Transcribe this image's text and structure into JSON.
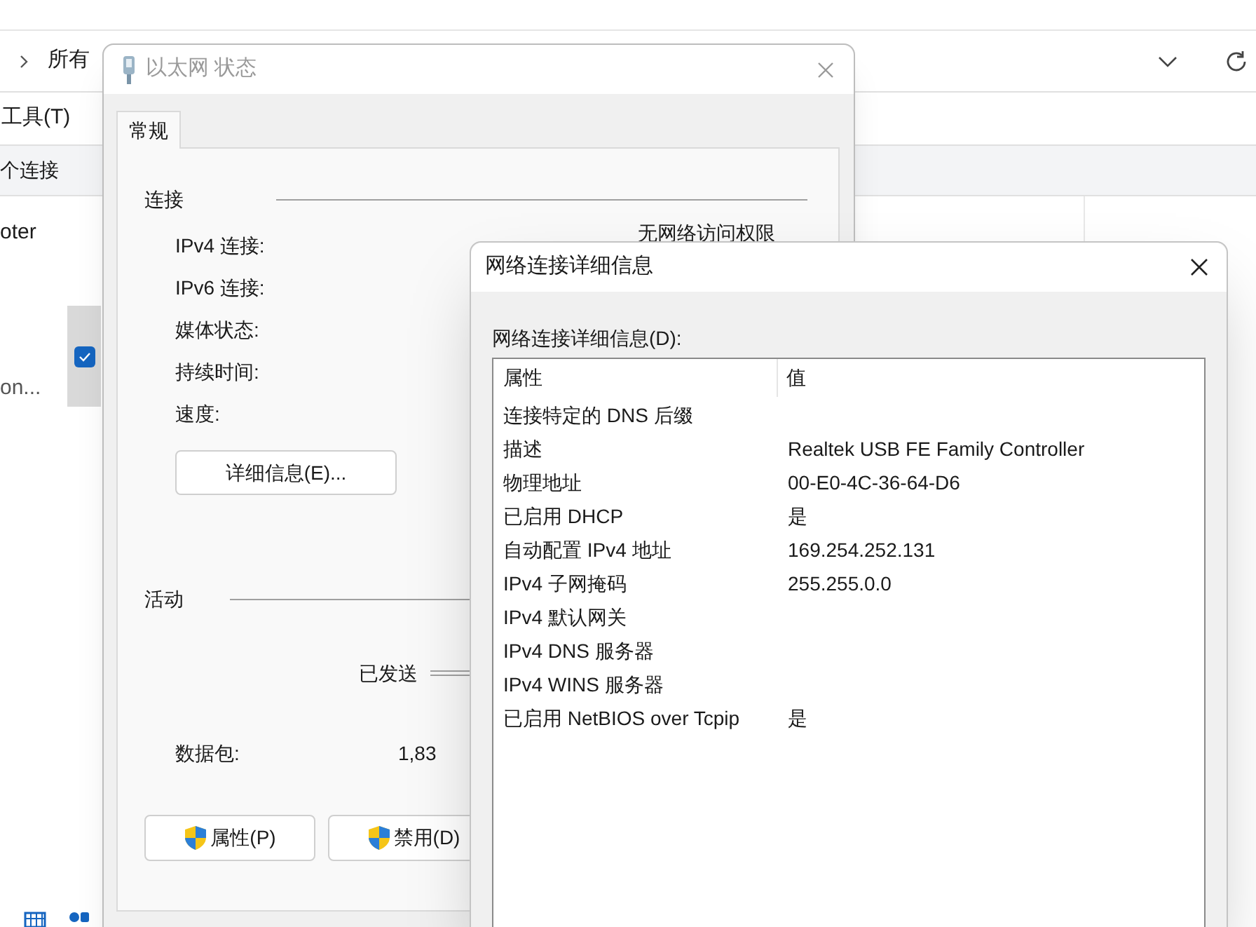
{
  "explorer": {
    "breadcrumb": "所有",
    "menu": "工具(T)",
    "toolbar_text": "个连接",
    "items": [
      {
        "label": "oter",
        "selected": false
      },
      {
        "label": "on...",
        "selected": true
      }
    ]
  },
  "status_dialog": {
    "title": "以太网 状态",
    "tabs": [
      {
        "label": "常规",
        "selected": true
      }
    ],
    "connection": {
      "heading": "连接",
      "rows": [
        {
          "label": "IPv4 连接:",
          "value": "无网络访问权限"
        },
        {
          "label": "IPv6 连接:"
        },
        {
          "label": "媒体状态:"
        },
        {
          "label": "持续时间:"
        },
        {
          "label": "速度:"
        }
      ]
    },
    "details_button": "详细信息(E)...",
    "activity": {
      "heading": "活动",
      "sent_label": "已发送",
      "packets_label": "数据包:",
      "packets_sent": "1,83"
    },
    "buttons": [
      "属性(P)",
      "禁用(D)"
    ]
  },
  "details_dialog": {
    "title": "网络连接详细信息",
    "list_label": "网络连接详细信息(D):",
    "columns": [
      "属性",
      "值"
    ],
    "rows": [
      {
        "property": "连接特定的 DNS 后缀"
      },
      {
        "property": "描述",
        "value": "Realtek USB FE Family Controller"
      },
      {
        "property": "物理地址",
        "value": "00-E0-4C-36-64-D6"
      },
      {
        "property": "已启用 DHCP",
        "value": "是"
      },
      {
        "property": "自动配置 IPv4 地址",
        "value": "169.254.252.131"
      },
      {
        "property": "IPv4 子网掩码",
        "value": "255.255.0.0"
      },
      {
        "property": "IPv4 默认网关"
      },
      {
        "property": "IPv4 DNS 服务器"
      },
      {
        "property": "IPv4 WINS 服务器"
      },
      {
        "property": "已启用 NetBIOS over Tcpip",
        "value": "是"
      }
    ]
  }
}
